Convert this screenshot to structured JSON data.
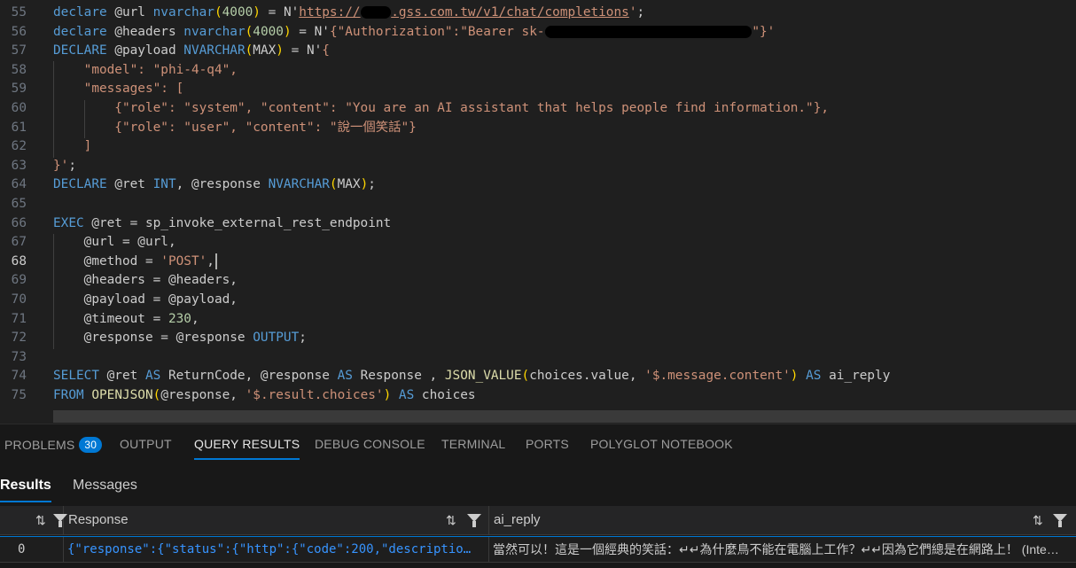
{
  "editor": {
    "active_line": "68",
    "lines": [
      {
        "n": "55",
        "t": [
          [
            "kw",
            "declare"
          ],
          [
            "plain",
            " @url "
          ],
          [
            "kw",
            "nvarchar"
          ],
          [
            "pu",
            "("
          ],
          [
            "num",
            "4000"
          ],
          [
            "pu",
            ")"
          ],
          [
            "plain",
            " = N'"
          ],
          [
            "url",
            "https://"
          ],
          [
            "redact",
            "xxxx"
          ],
          [
            "url",
            ".gss.com.tw/v1/chat/completions"
          ],
          [
            "str",
            "'"
          ],
          [
            "plain",
            ";"
          ]
        ]
      },
      {
        "n": "56",
        "t": [
          [
            "kw",
            "declare"
          ],
          [
            "plain",
            " @headers "
          ],
          [
            "kw",
            "nvarchar"
          ],
          [
            "pu",
            "("
          ],
          [
            "num",
            "4000"
          ],
          [
            "pu",
            ")"
          ],
          [
            "plain",
            " = N'"
          ],
          [
            "str",
            "{\"Authorization\":\"Bearer sk-"
          ],
          [
            "redact",
            "xxxxxxxxxxxxxxxxxxxxxxxxxxx"
          ],
          [
            "str",
            "\"}'"
          ]
        ]
      },
      {
        "n": "57",
        "t": [
          [
            "kw",
            "DECLARE"
          ],
          [
            "plain",
            " @payload "
          ],
          [
            "kw",
            "NVARCHAR"
          ],
          [
            "pu",
            "("
          ],
          [
            "plain",
            "MAX"
          ],
          [
            "pu",
            ")"
          ],
          [
            "plain",
            " = N'"
          ],
          [
            "str",
            "{"
          ]
        ]
      },
      {
        "n": "58",
        "t": [
          [
            "str",
            "    \"model\": \"phi-4-q4\","
          ]
        ]
      },
      {
        "n": "59",
        "t": [
          [
            "str",
            "    \"messages\": ["
          ]
        ]
      },
      {
        "n": "60",
        "t": [
          [
            "str",
            "        {\"role\": \"system\", \"content\": \"You are an AI assistant that helps people find information.\"},"
          ]
        ]
      },
      {
        "n": "61",
        "t": [
          [
            "str",
            "        {\"role\": \"user\", \"content\": \"說一個笑話\"}"
          ]
        ]
      },
      {
        "n": "62",
        "t": [
          [
            "str",
            "    ]"
          ]
        ]
      },
      {
        "n": "63",
        "t": [
          [
            "str",
            "}'"
          ],
          [
            "plain",
            ";"
          ]
        ]
      },
      {
        "n": "64",
        "t": [
          [
            "kw",
            "DECLARE"
          ],
          [
            "plain",
            " @ret "
          ],
          [
            "kw",
            "INT"
          ],
          [
            "plain",
            ", @response "
          ],
          [
            "kw",
            "NVARCHAR"
          ],
          [
            "pu",
            "("
          ],
          [
            "plain",
            "MAX"
          ],
          [
            "pu",
            ")"
          ],
          [
            "plain",
            ";"
          ]
        ]
      },
      {
        "n": "65",
        "t": []
      },
      {
        "n": "66",
        "t": [
          [
            "kw",
            "EXEC"
          ],
          [
            "plain",
            " @ret = sp_invoke_external_rest_endpoint"
          ]
        ]
      },
      {
        "n": "67",
        "t": [
          [
            "plain",
            "    @url = @url,"
          ]
        ]
      },
      {
        "n": "68",
        "t": [
          [
            "plain",
            "    @method = "
          ],
          [
            "str",
            "'POST'"
          ],
          [
            "plain",
            ","
          ],
          [
            "cursor",
            ""
          ]
        ]
      },
      {
        "n": "69",
        "t": [
          [
            "plain",
            "    @headers = @headers,"
          ]
        ]
      },
      {
        "n": "70",
        "t": [
          [
            "plain",
            "    @payload = @payload,"
          ]
        ]
      },
      {
        "n": "71",
        "t": [
          [
            "plain",
            "    @timeout = "
          ],
          [
            "num",
            "230"
          ],
          [
            "plain",
            ","
          ]
        ]
      },
      {
        "n": "72",
        "t": [
          [
            "plain",
            "    @response = @response "
          ],
          [
            "kw",
            "OUTPUT"
          ],
          [
            "plain",
            ";"
          ]
        ]
      },
      {
        "n": "73",
        "t": []
      },
      {
        "n": "74",
        "t": [
          [
            "kw",
            "SELECT"
          ],
          [
            "plain",
            " @ret "
          ],
          [
            "kw",
            "AS"
          ],
          [
            "plain",
            " ReturnCode, @response "
          ],
          [
            "kw",
            "AS"
          ],
          [
            "plain",
            " Response , "
          ],
          [
            "fn",
            "JSON_VALUE"
          ],
          [
            "pu",
            "("
          ],
          [
            "plain",
            "choices.value, "
          ],
          [
            "str",
            "'$.message.content'"
          ],
          [
            "pu",
            ")"
          ],
          [
            "plain",
            " "
          ],
          [
            "kw",
            "AS"
          ],
          [
            "plain",
            " ai_reply"
          ]
        ]
      },
      {
        "n": "75",
        "t": [
          [
            "kw",
            "FROM"
          ],
          [
            "plain",
            " "
          ],
          [
            "fn",
            "OPENJSON"
          ],
          [
            "pu",
            "("
          ],
          [
            "plain",
            "@response, "
          ],
          [
            "str",
            "'$.result.choices'"
          ],
          [
            "pu",
            ")"
          ],
          [
            "plain",
            " "
          ],
          [
            "kw",
            "AS"
          ],
          [
            "plain",
            " choices"
          ]
        ]
      }
    ]
  },
  "panel": {
    "tabs": [
      {
        "id": "problems",
        "label": "PROBLEMS",
        "badge": "30"
      },
      {
        "id": "output",
        "label": "OUTPUT"
      },
      {
        "id": "query-results",
        "label": "QUERY RESULTS",
        "active": true
      },
      {
        "id": "debug-console",
        "label": "DEBUG CONSOLE"
      },
      {
        "id": "terminal",
        "label": "TERMINAL"
      },
      {
        "id": "ports",
        "label": "PORTS"
      },
      {
        "id": "polyglot-notebook",
        "label": "POLYGLOT NOTEBOOK"
      }
    ],
    "subtabs": {
      "results": "Results",
      "messages": "Messages"
    },
    "grid": {
      "columns": [
        "",
        "Response",
        "ai_reply"
      ],
      "sort_icon": "⇅",
      "row": {
        "returncode": "0",
        "response": "{\"response\":{\"status\":{\"http\":{\"code\":200,\"descriptio…",
        "ai_reply": "當然可以！這是一個經典的笑話：↵↵為什麼鳥不能在電腦上工作？↵↵因為它們總是在網路上！ (Inte…"
      }
    }
  },
  "colors": {
    "accent": "#0078d4",
    "keyword": "#569cd6",
    "string": "#ce9178",
    "number": "#b5cea8"
  }
}
